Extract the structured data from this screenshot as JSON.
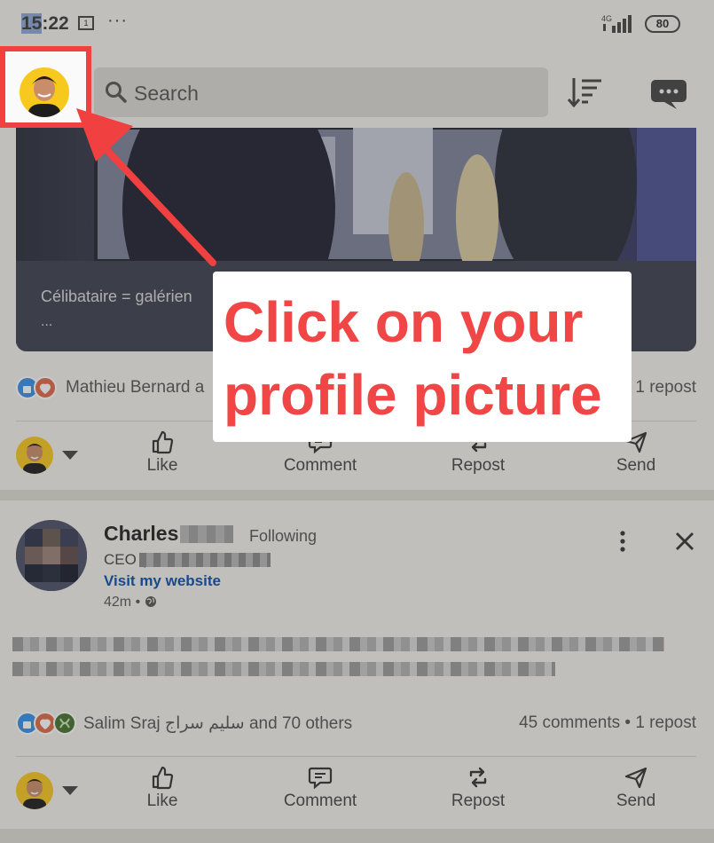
{
  "status_bar": {
    "time_prefix": "15",
    "time_suffix": ":22",
    "more": "···",
    "network": "4G",
    "battery": "80"
  },
  "top_bar": {
    "search_placeholder": "Search"
  },
  "post1": {
    "video_caption": "Célibataire = galérien",
    "video_caption_more": "...",
    "reactions_text": "Mathieu Bernard a",
    "reactions_right": "1 repost"
  },
  "actions": {
    "like": "Like",
    "comment": "Comment",
    "repost": "Repost",
    "send": "Send"
  },
  "post2": {
    "author_first_name": "Charles",
    "following": "Following",
    "title_prefix": "CEO (",
    "link": "Visit my website",
    "time": "42m •",
    "reactions_text": "Salim Sraj سليم سراج and 70 others",
    "reactions_right": "45 comments • 1 repost"
  },
  "annotation": {
    "callout": "Click on your profile picture",
    "highlight_color": "#f04040"
  }
}
